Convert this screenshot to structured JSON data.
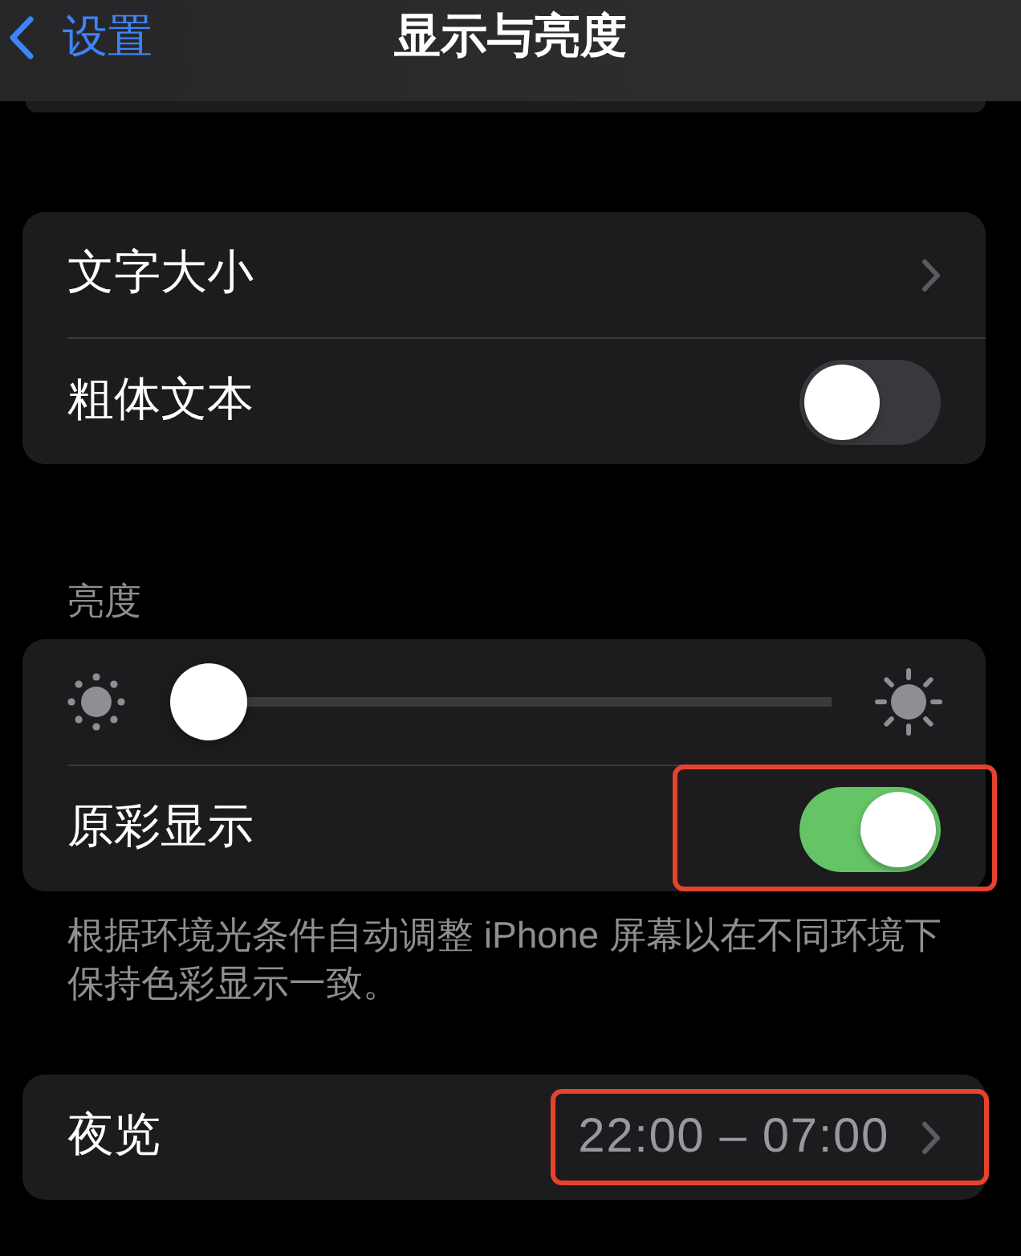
{
  "nav_bar": {
    "back_label": "设置",
    "title": "显示与亮度"
  },
  "groups": [
    {
      "rows": [
        {
          "kind": "link",
          "label": "文字大小",
          "highlighted": false
        },
        {
          "kind": "toggle",
          "label": "粗体文本",
          "on": false,
          "highlighted": false
        }
      ]
    },
    {
      "header": "亮度",
      "rows": [
        {
          "kind": "slider",
          "level": 0,
          "highlighted": false
        },
        {
          "kind": "toggle",
          "label": "原彩显示",
          "on": true,
          "highlighted": true
        }
      ],
      "footer": "根据环境光条件自动调整 iPhone 屏幕以在不同环境下保持色彩显示一致。"
    },
    {
      "rows": [
        {
          "kind": "link",
          "label": "夜览",
          "value": "22:00 – 07:00",
          "highlighted": true
        }
      ]
    }
  ]
}
